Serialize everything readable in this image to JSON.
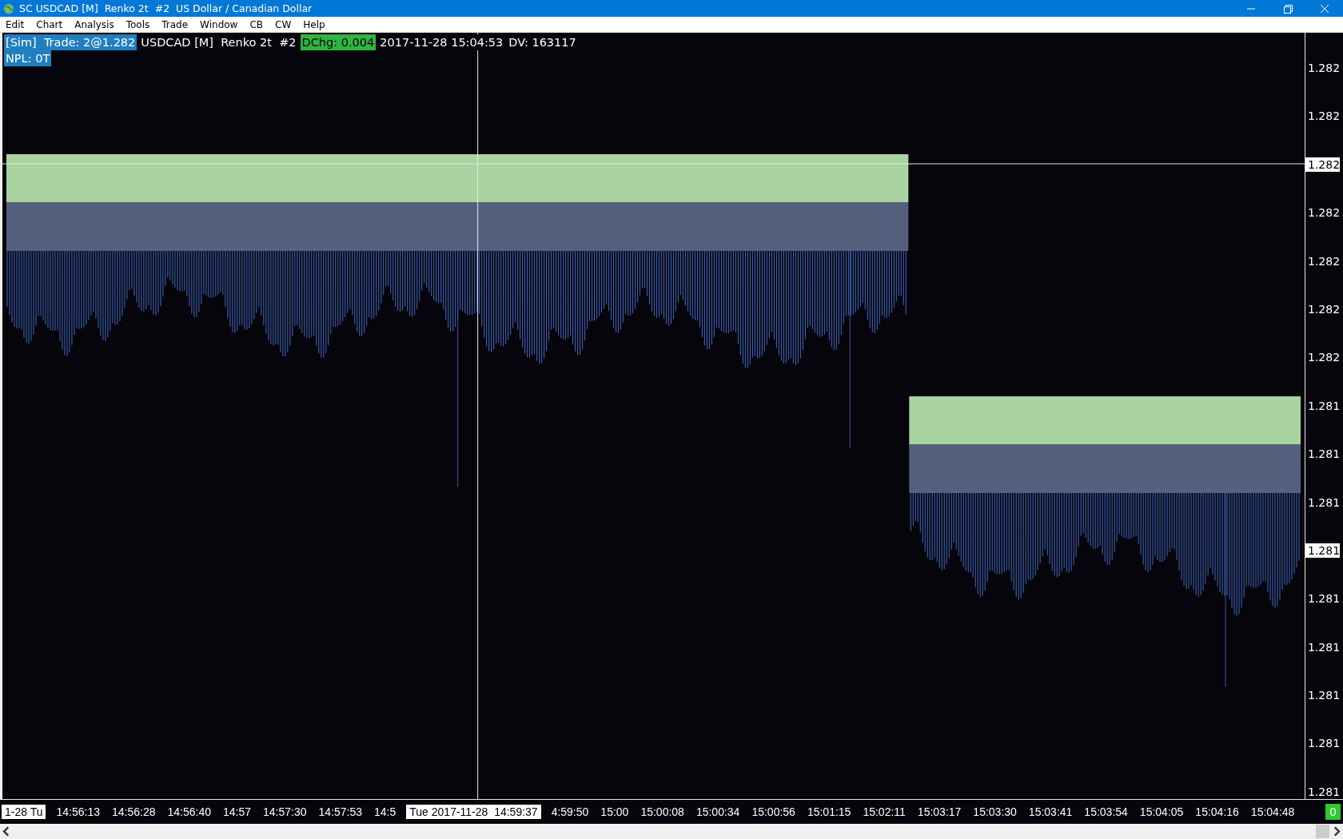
{
  "window": {
    "title": "SC USDCAD [M]  Renko 2t  #2  US Dollar / Canadian Dollar"
  },
  "menu": [
    "Edit",
    "Chart",
    "Analysis",
    "Tools",
    "Trade",
    "Window",
    "CB",
    "CW",
    "Help"
  ],
  "header": {
    "line1": [
      {
        "text": "[Sim]  Trade: 2@1.282",
        "kind": "blue"
      },
      {
        "text": "USDCAD [M]  Renko 2t  #2",
        "kind": "plain"
      },
      {
        "text": "DChg: 0.004",
        "kind": "green"
      },
      {
        "text": "2017-11-28 15:04:53",
        "kind": "plain"
      },
      {
        "text": "DV: 163117",
        "kind": "plain"
      }
    ],
    "line2": [
      {
        "text": "NPL: 0T",
        "kind": "blue"
      }
    ]
  },
  "price_axis": [
    {
      "label": "1.282",
      "highlighted": false
    },
    {
      "label": "1.282",
      "highlighted": false
    },
    {
      "label": "1.282",
      "highlighted": true
    },
    {
      "label": "1.282",
      "highlighted": false
    },
    {
      "label": "1.282",
      "highlighted": false
    },
    {
      "label": "1.282",
      "highlighted": false
    },
    {
      "label": "1.282",
      "highlighted": false
    },
    {
      "label": "1.281",
      "highlighted": false
    },
    {
      "label": "1.281",
      "highlighted": false
    },
    {
      "label": "1.281",
      "highlighted": false
    },
    {
      "label": "1.281",
      "highlighted": true
    },
    {
      "label": "1.281",
      "highlighted": false
    },
    {
      "label": "1.281",
      "highlighted": false
    },
    {
      "label": "1.281",
      "highlighted": false
    },
    {
      "label": "1.281",
      "highlighted": false
    },
    {
      "label": "1.281",
      "highlighted": false
    }
  ],
  "time_axis": [
    {
      "label": "1-28 Tu",
      "highlighted": true
    },
    {
      "label": "14:56:13",
      "highlighted": false
    },
    {
      "label": "14:56:28",
      "highlighted": false
    },
    {
      "label": "14:56:40",
      "highlighted": false
    },
    {
      "label": "14:57",
      "highlighted": false
    },
    {
      "label": "14:57:30",
      "highlighted": false
    },
    {
      "label": "14:57:53",
      "highlighted": false
    },
    {
      "label": "14:5",
      "highlighted": false
    },
    {
      "label": "Tue 2017-11-28  14:59:37",
      "highlighted": true
    },
    {
      "label": "4:59:50",
      "highlighted": false
    },
    {
      "label": "15:00",
      "highlighted": false
    },
    {
      "label": "15:00:08",
      "highlighted": false
    },
    {
      "label": "15:00:34",
      "highlighted": false
    },
    {
      "label": "15:00:56",
      "highlighted": false
    },
    {
      "label": "15:01:15",
      "highlighted": false
    },
    {
      "label": "15:02:11",
      "highlighted": false
    },
    {
      "label": "15:03:17",
      "highlighted": false
    },
    {
      "label": "15:03:30",
      "highlighted": false
    },
    {
      "label": "15:03:41",
      "highlighted": false
    },
    {
      "label": "15:03:54",
      "highlighted": false
    },
    {
      "label": "15:04:05",
      "highlighted": false
    },
    {
      "label": "15:04:16",
      "highlighted": false
    },
    {
      "label": "15:04:48",
      "highlighted": false
    }
  ],
  "corner_badge": "0"
}
